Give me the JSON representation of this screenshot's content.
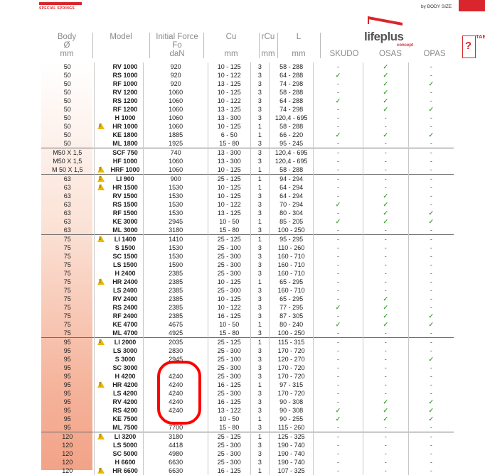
{
  "header": {
    "left_brand": "SPECIAL SPRINGS",
    "by_body_size": "by BODY SIZE",
    "logo_main": "lifeplus",
    "logo_sub": "concept",
    "tab_label": "TAB"
  },
  "columns": {
    "body": [
      "Body",
      "Ø",
      "mm"
    ],
    "model": "Model",
    "force": [
      "Initial Force",
      "Fo",
      "daN"
    ],
    "cu": [
      "Cu",
      "mm"
    ],
    "rcu": [
      "rCu",
      "mm"
    ],
    "l": [
      "L",
      "mm"
    ],
    "skudo": "SKUDO",
    "osas": "OSAS",
    "opas": "OPAS"
  },
  "rows": [
    {
      "body": "50",
      "warn": false,
      "model": "RV 1000",
      "force": "920",
      "cu": "10 - 125",
      "rcu": "3",
      "l": "58 - 288",
      "sk": "-",
      "os": "✓",
      "op": "-"
    },
    {
      "body": "50",
      "warn": false,
      "model": "RS 1000",
      "force": "920",
      "cu": "10 - 122",
      "rcu": "3",
      "l": "64 - 288",
      "sk": "✓",
      "os": "✓",
      "op": "-"
    },
    {
      "body": "50",
      "warn": false,
      "model": "RF 1000",
      "force": "920",
      "cu": "13 - 125",
      "rcu": "3",
      "l": "74 - 298",
      "sk": "-",
      "os": "✓",
      "op": "✓"
    },
    {
      "body": "50",
      "warn": false,
      "model": "RV 1200",
      "force": "1060",
      "cu": "10 - 125",
      "rcu": "3",
      "l": "58 - 288",
      "sk": "-",
      "os": "✓",
      "op": "-"
    },
    {
      "body": "50",
      "warn": false,
      "model": "RS 1200",
      "force": "1060",
      "cu": "10 - 122",
      "rcu": "3",
      "l": "64 - 288",
      "sk": "✓",
      "os": "✓",
      "op": "-"
    },
    {
      "body": "50",
      "warn": false,
      "model": "RF 1200",
      "force": "1060",
      "cu": "13 - 125",
      "rcu": "3",
      "l": "74 - 298",
      "sk": "-",
      "os": "✓",
      "op": "✓"
    },
    {
      "body": "50",
      "warn": false,
      "model": "H 1000",
      "force": "1060",
      "cu": "13 - 300",
      "rcu": "3",
      "l": "120,4 - 695",
      "sk": "-",
      "os": "-",
      "op": "-"
    },
    {
      "body": "50",
      "warn": true,
      "model": "HR 1000",
      "force": "1060",
      "cu": "10 - 125",
      "rcu": "1",
      "l": "58 - 288",
      "sk": "-",
      "os": "-",
      "op": "-"
    },
    {
      "body": "50",
      "warn": false,
      "model": "KE 1800",
      "force": "1885",
      "cu": "6 - 50",
      "rcu": "1",
      "l": "66 - 220",
      "sk": "✓",
      "os": "✓",
      "op": "✓"
    },
    {
      "body": "50",
      "warn": false,
      "model": "ML 1800",
      "force": "1925",
      "cu": "15 - 80",
      "rcu": "3",
      "l": "95 - 245",
      "sk": "-",
      "os": "-",
      "op": "-"
    },
    {
      "body": "M50 X 1,5",
      "warn": false,
      "model": "SCF 750",
      "force": "740",
      "cu": "13 - 300",
      "rcu": "3",
      "l": "120,4 - 695",
      "sk": "-",
      "os": "-",
      "op": "-",
      "gs": true
    },
    {
      "body": "M50 X 1,5",
      "warn": false,
      "model": "HF 1000",
      "force": "1060",
      "cu": "13 - 300",
      "rcu": "3",
      "l": "120,4 - 695",
      "sk": "-",
      "os": "-",
      "op": "-"
    },
    {
      "body": "M 50 X 1,5",
      "warn": true,
      "model": "HRF 1000",
      "force": "1060",
      "cu": "10 - 125",
      "rcu": "1",
      "l": "58 - 288",
      "sk": "-",
      "os": "-",
      "op": "-"
    },
    {
      "body": "63",
      "warn": true,
      "model": "LI 900",
      "force": "900",
      "cu": "25 - 125",
      "rcu": "1",
      "l": "94 - 294",
      "sk": "-",
      "os": "-",
      "op": "-",
      "gs": true
    },
    {
      "body": "63",
      "warn": true,
      "model": "HR 1500",
      "force": "1530",
      "cu": "10 - 125",
      "rcu": "1",
      "l": "64 - 294",
      "sk": "-",
      "os": "-",
      "op": "-"
    },
    {
      "body": "63",
      "warn": false,
      "model": "RV 1500",
      "force": "1530",
      "cu": "10 - 125",
      "rcu": "3",
      "l": "64 - 294",
      "sk": "-",
      "os": "✓",
      "op": "-"
    },
    {
      "body": "63",
      "warn": false,
      "model": "RS 1500",
      "force": "1530",
      "cu": "10 - 122",
      "rcu": "3",
      "l": "70 - 294",
      "sk": "✓",
      "os": "✓",
      "op": "-"
    },
    {
      "body": "63",
      "warn": false,
      "model": "RF 1500",
      "force": "1530",
      "cu": "13 - 125",
      "rcu": "3",
      "l": "80 - 304",
      "sk": "-",
      "os": "✓",
      "op": "✓"
    },
    {
      "body": "63",
      "warn": false,
      "model": "KE 3000",
      "force": "2945",
      "cu": "10 - 50",
      "rcu": "1",
      "l": "85 - 205",
      "sk": "✓",
      "os": "✓",
      "op": "✓"
    },
    {
      "body": "63",
      "warn": false,
      "model": "ML 3000",
      "force": "3180",
      "cu": "15 - 80",
      "rcu": "3",
      "l": "100 - 250",
      "sk": "-",
      "os": "-",
      "op": "-"
    },
    {
      "body": "75",
      "warn": true,
      "model": "LI 1400",
      "force": "1410",
      "cu": "25 - 125",
      "rcu": "1",
      "l": "95 - 295",
      "sk": "-",
      "os": "-",
      "op": "-",
      "gs": true
    },
    {
      "body": "75",
      "warn": false,
      "model": "S 1500",
      "force": "1530",
      "cu": "25 - 100",
      "rcu": "3",
      "l": "110 - 260",
      "sk": "-",
      "os": "-",
      "op": "-"
    },
    {
      "body": "75",
      "warn": false,
      "model": "SC 1500",
      "force": "1530",
      "cu": "25 - 300",
      "rcu": "3",
      "l": "160 - 710",
      "sk": "-",
      "os": "-",
      "op": "-"
    },
    {
      "body": "75",
      "warn": false,
      "model": "LS 1500",
      "force": "1590",
      "cu": "25 - 300",
      "rcu": "3",
      "l": "160 - 710",
      "sk": "-",
      "os": "-",
      "op": "-"
    },
    {
      "body": "75",
      "warn": false,
      "model": "H 2400",
      "force": "2385",
      "cu": "25 - 300",
      "rcu": "3",
      "l": "160 - 710",
      "sk": "-",
      "os": "-",
      "op": "-"
    },
    {
      "body": "75",
      "warn": true,
      "model": "HR 2400",
      "force": "2385",
      "cu": "10 - 125",
      "rcu": "1",
      "l": "65 - 295",
      "sk": "-",
      "os": "-",
      "op": "-"
    },
    {
      "body": "75",
      "warn": false,
      "model": "LS 2400",
      "force": "2385",
      "cu": "25 - 300",
      "rcu": "3",
      "l": "160 - 710",
      "sk": "-",
      "os": "-",
      "op": "-"
    },
    {
      "body": "75",
      "warn": false,
      "model": "RV 2400",
      "force": "2385",
      "cu": "10 - 125",
      "rcu": "3",
      "l": "65 - 295",
      "sk": "-",
      "os": "✓",
      "op": "-"
    },
    {
      "body": "75",
      "warn": false,
      "model": "RS 2400",
      "force": "2385",
      "cu": "10 - 122",
      "rcu": "3",
      "l": "77 - 295",
      "sk": "✓",
      "os": "✓",
      "op": "-"
    },
    {
      "body": "75",
      "warn": false,
      "model": "RF 2400",
      "force": "2385",
      "cu": "16 - 125",
      "rcu": "3",
      "l": "87 - 305",
      "sk": "-",
      "os": "✓",
      "op": "✓"
    },
    {
      "body": "75",
      "warn": false,
      "model": "KE 4700",
      "force": "4675",
      "cu": "10 - 50",
      "rcu": "1",
      "l": "80 - 240",
      "sk": "✓",
      "os": "✓",
      "op": "✓"
    },
    {
      "body": "75",
      "warn": false,
      "model": "ML 4700",
      "force": "4925",
      "cu": "15 - 80",
      "rcu": "3",
      "l": "100 - 250",
      "sk": "-",
      "os": "-",
      "op": "-"
    },
    {
      "body": "95",
      "warn": true,
      "model": "LI 2000",
      "force": "2035",
      "cu": "25 - 125",
      "rcu": "1",
      "l": "115 - 315",
      "sk": "-",
      "os": "-",
      "op": "-",
      "gs": true
    },
    {
      "body": "95",
      "warn": false,
      "model": "LS 3000",
      "force": "2830",
      "cu": "25 - 300",
      "rcu": "3",
      "l": "170 - 720",
      "sk": "-",
      "os": "-",
      "op": "-"
    },
    {
      "body": "95",
      "warn": false,
      "model": "S 3000",
      "force": "2945",
      "cu": "25 - 100",
      "rcu": "3",
      "l": "120 - 270",
      "sk": "-",
      "os": "-",
      "op": "✓"
    },
    {
      "body": "95",
      "warn": false,
      "model": "SC 3000",
      "force": "",
      "cu": "25 - 300",
      "rcu": "3",
      "l": "170 - 720",
      "sk": "-",
      "os": "-",
      "op": "-"
    },
    {
      "body": "95",
      "warn": false,
      "model": "H 4200",
      "force": "4240",
      "cu": "25 - 300",
      "rcu": "3",
      "l": "170 - 720",
      "sk": "-",
      "os": "-",
      "op": "-"
    },
    {
      "body": "95",
      "warn": true,
      "model": "HR 4200",
      "force": "4240",
      "cu": "16 - 125",
      "rcu": "1",
      "l": "97 - 315",
      "sk": "-",
      "os": "-",
      "op": "-"
    },
    {
      "body": "95",
      "warn": false,
      "model": "LS 4200",
      "force": "4240",
      "cu": "25 - 300",
      "rcu": "3",
      "l": "170 - 720",
      "sk": "-",
      "os": "-",
      "op": "-"
    },
    {
      "body": "95",
      "warn": false,
      "model": "RV 4200",
      "force": "4240",
      "cu": "16 - 125",
      "rcu": "3",
      "l": "90 - 308",
      "sk": "-",
      "os": "✓",
      "op": "✓"
    },
    {
      "body": "95",
      "warn": false,
      "model": "RS 4200",
      "force": "4240",
      "cu": "13 - 122",
      "rcu": "3",
      "l": "90 - 308",
      "sk": "✓",
      "os": "✓",
      "op": "✓"
    },
    {
      "body": "95",
      "warn": false,
      "model": "KE 7500",
      "force": "",
      "cu": "10 - 50",
      "rcu": "1",
      "l": "90 - 255",
      "sk": "✓",
      "os": "✓",
      "op": "✓"
    },
    {
      "body": "95",
      "warn": false,
      "model": "ML 7500",
      "force": "7700",
      "cu": "15 - 80",
      "rcu": "3",
      "l": "115 - 260",
      "sk": "-",
      "os": "-",
      "op": "-"
    },
    {
      "body": "120",
      "warn": true,
      "model": "LI 3200",
      "force": "3180",
      "cu": "25 - 125",
      "rcu": "1",
      "l": "125 - 325",
      "sk": "-",
      "os": "-",
      "op": "-",
      "gs": true
    },
    {
      "body": "120",
      "warn": false,
      "model": "LS 5000",
      "force": "4418",
      "cu": "25 - 300",
      "rcu": "3",
      "l": "190 - 740",
      "sk": "-",
      "os": "-",
      "op": "-"
    },
    {
      "body": "120",
      "warn": false,
      "model": "SC 5000",
      "force": "4980",
      "cu": "25 - 300",
      "rcu": "3",
      "l": "190 - 740",
      "sk": "-",
      "os": "-",
      "op": "-"
    },
    {
      "body": "120",
      "warn": false,
      "model": "H 6600",
      "force": "6630",
      "cu": "25 - 300",
      "rcu": "3",
      "l": "190 - 740",
      "sk": "-",
      "os": "-",
      "op": "-"
    },
    {
      "body": "120",
      "warn": true,
      "model": "HR 6600",
      "force": "6630",
      "cu": "16 - 125",
      "rcu": "1",
      "l": "107 - 325",
      "sk": "-",
      "os": "-",
      "op": "-"
    }
  ]
}
